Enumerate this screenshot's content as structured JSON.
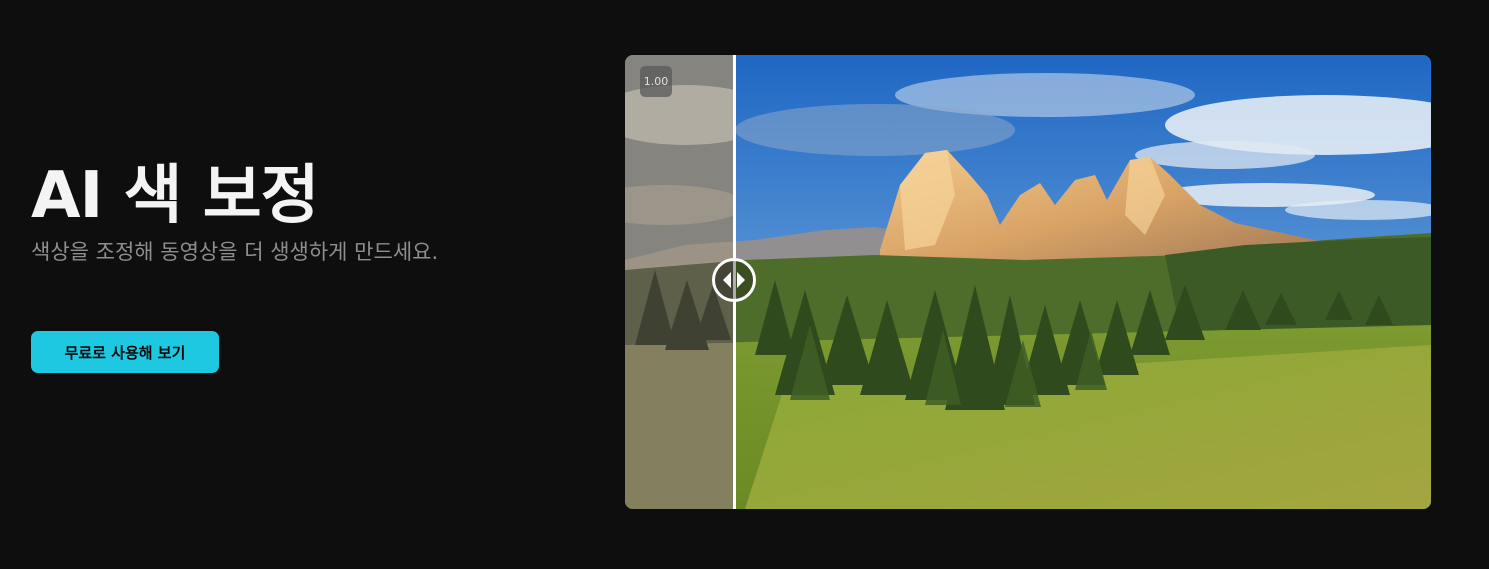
{
  "hero": {
    "title": "AI 색 보정",
    "subtitle": "색상을 조정해 동영상을 더 생생하게 만드세요.",
    "cta_label": "무료로 사용해 보기"
  },
  "comparison": {
    "speed_badge": "1.00",
    "slider_position": 0.135,
    "before_label": "",
    "after_label": ""
  },
  "colors": {
    "background": "#0e0e0e",
    "accent": "#1ec8e0",
    "title": "#f4f4f4",
    "subtitle": "#8e8e8e"
  },
  "icons": {
    "handle": "left-right-arrows-icon"
  }
}
